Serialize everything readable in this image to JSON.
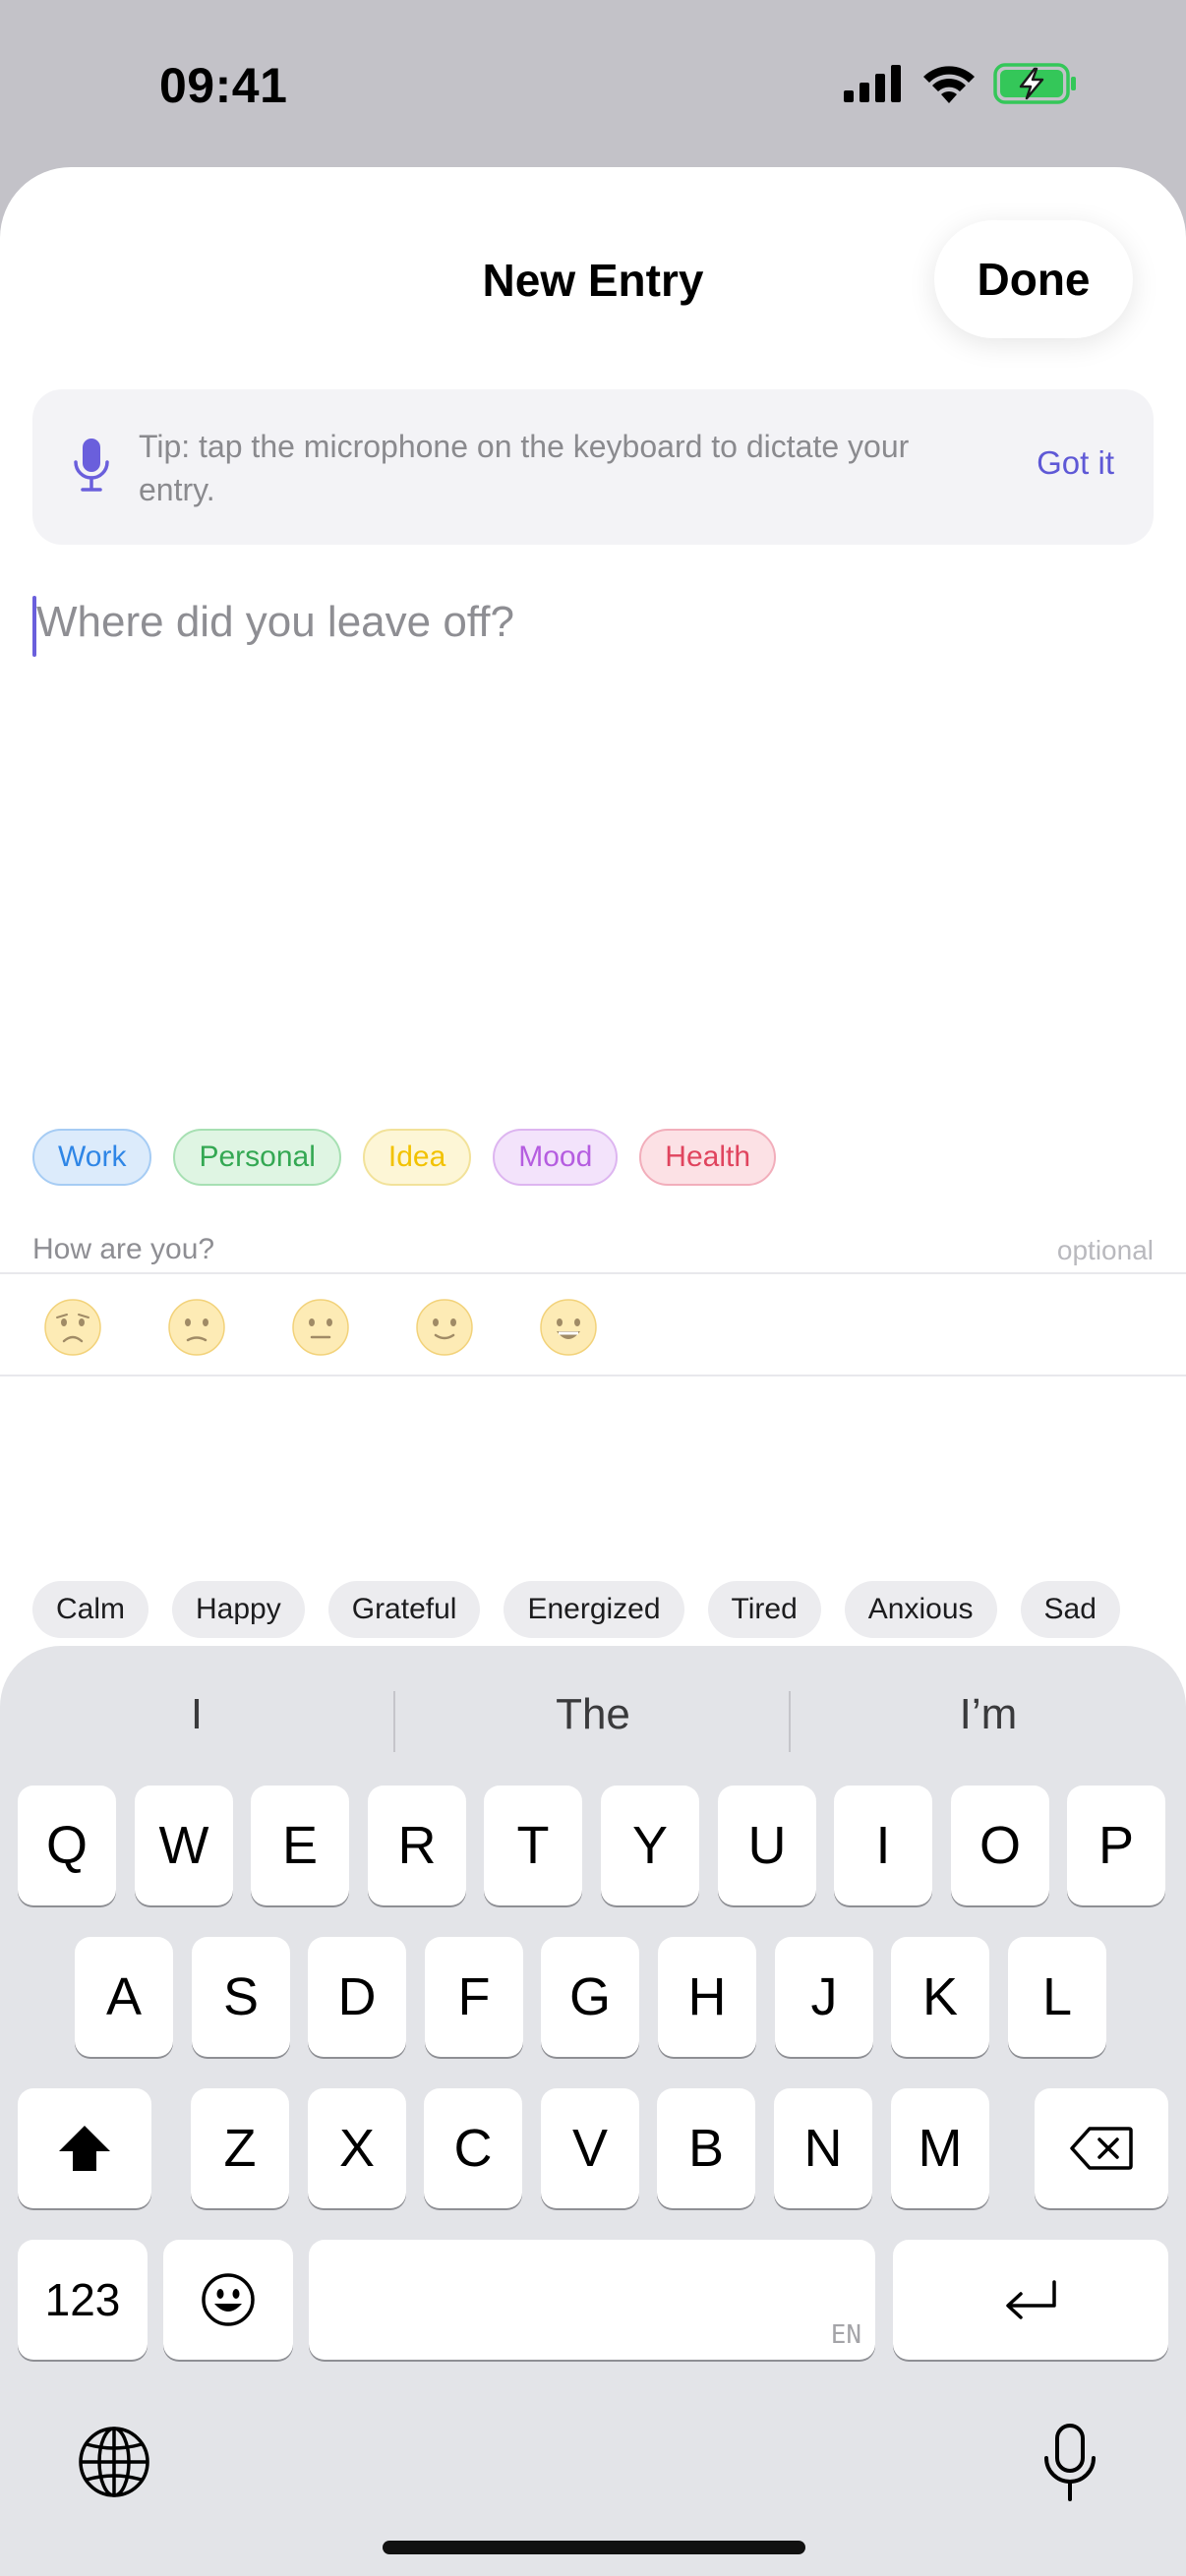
{
  "status_bar": {
    "time": "09:41",
    "icons": [
      "cellular-signal-icon",
      "wifi-icon",
      "battery-charging-icon"
    ],
    "battery_color": "#34c759"
  },
  "sheet": {
    "title": "New Entry",
    "done_label": "Done"
  },
  "tip": {
    "icon": "microphone-icon",
    "text": "Tip: tap the microphone on the keyboard to dictate your entry.",
    "dismiss_label": "Got it",
    "accent": "#5e58d6"
  },
  "editor": {
    "placeholder": "Where did you leave off?",
    "value": ""
  },
  "tags": [
    {
      "label": "Work",
      "color": "#2f86e6",
      "bg": "#dcebfb",
      "border": "#a6ccf4"
    },
    {
      "label": "Personal",
      "color": "#34a853",
      "bg": "#dff5e3",
      "border": "#a7e0b3"
    },
    {
      "label": "Idea",
      "color": "#f2c200",
      "bg": "#fdf6d6",
      "border": "#f2e29a"
    },
    {
      "label": "Mood",
      "color": "#b55de0",
      "bg": "#f3e3fb",
      "border": "#ddb5f0"
    },
    {
      "label": "Health",
      "color": "#e0445e",
      "bg": "#fce1e5",
      "border": "#f2aebb"
    }
  ],
  "mood": {
    "label": "How are you?",
    "optional_label": "optional",
    "faces": [
      "very-sad-face-icon",
      "sad-face-icon",
      "neutral-face-icon",
      "slight-smile-face-icon",
      "grin-face-icon"
    ],
    "feelings": [
      "Calm",
      "Happy",
      "Grateful",
      "Energized",
      "Tired",
      "Anxious",
      "Sad"
    ]
  },
  "keyboard": {
    "suggestions": [
      "I",
      "The",
      "I’m"
    ],
    "row1": [
      "Q",
      "W",
      "E",
      "R",
      "T",
      "Y",
      "U",
      "I",
      "O",
      "P"
    ],
    "row2": [
      "A",
      "S",
      "D",
      "F",
      "G",
      "H",
      "J",
      "K",
      "L"
    ],
    "row3": [
      "Z",
      "X",
      "C",
      "V",
      "B",
      "N",
      "M"
    ],
    "numbers_label": "123",
    "space_language": "EN",
    "shift_icon": "shift-icon",
    "delete_icon": "delete-icon",
    "emoji_icon": "emoji-icon",
    "return_icon": "return-icon",
    "globe_icon": "globe-icon",
    "dictation_icon": "microphone-icon"
  }
}
